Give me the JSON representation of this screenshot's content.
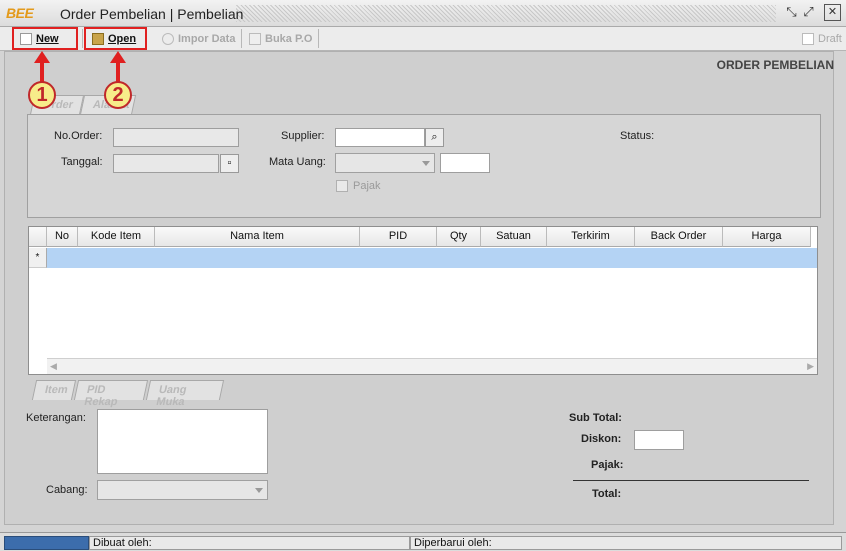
{
  "window": {
    "logo": "BEE",
    "title": "Order Pembelian | Pembelian"
  },
  "toolbar": {
    "new_label": "New",
    "open_label": "Open",
    "import_label": "Impor Data",
    "bukapo_label": "Buka P.O",
    "draft_label": "Draft"
  },
  "heading": "ORDER PEMBELIAN",
  "top_tabs": [
    "Order",
    "Alamat"
  ],
  "form": {
    "no_order_label": "No.Order:",
    "tanggal_label": "Tanggal:",
    "supplier_label": "Supplier:",
    "mata_uang_label": "Mata Uang:",
    "pajak_label": "Pajak",
    "status_label": "Status:"
  },
  "grid": {
    "columns": [
      "No",
      "Kode Item",
      "Nama Item",
      "PID",
      "Qty",
      "Satuan",
      "Terkirim",
      "Back Order",
      "Harga"
    ],
    "new_row_marker": "*"
  },
  "bottom_tabs": [
    "Item",
    "PID Rekap",
    "Uang Muka"
  ],
  "footer": {
    "keterangan_label": "Keterangan:",
    "cabang_label": "Cabang:",
    "subtotal_label": "Sub Total:",
    "diskon_label": "Diskon:",
    "pajak_label": "Pajak:",
    "total_label": "Total:"
  },
  "status_bar": {
    "dibuat": "Dibuat oleh:",
    "diperbarui": "Diperbarui oleh:"
  },
  "callouts": [
    "1",
    "2"
  ],
  "colors": {
    "accent": "#e02020",
    "new_row": "#b4d3f4",
    "logo": "#e39a1b"
  }
}
